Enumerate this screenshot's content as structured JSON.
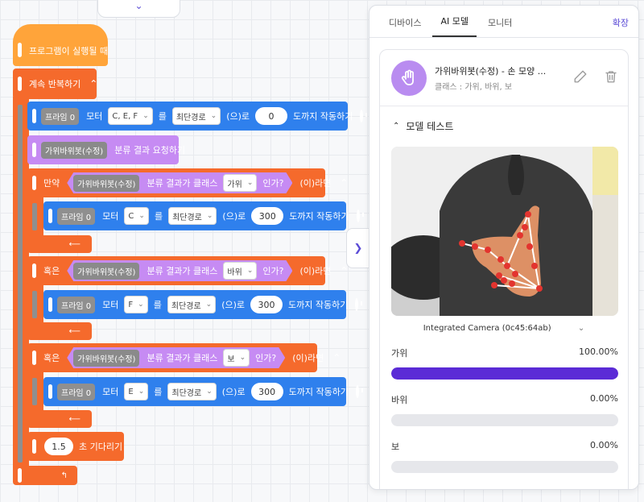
{
  "canvas": {
    "hat_label": "프로그램이 실행될 때",
    "loop_label": "계속 반복하기",
    "motor_block_1": {
      "device": "프라임 0",
      "motor_label": "모터",
      "motors": "C, E, F",
      "particle": "를",
      "mode": "최단경로",
      "suffix_to": "(으)로",
      "value": "0",
      "action": "도까지 작동하기"
    },
    "classify_block": {
      "model": "가위바위봇(수정)",
      "label": "분류 결과 요청하기"
    },
    "if_block": {
      "keyword": "만약",
      "model": "가위바위봇(수정)",
      "cond_label": "분류 결과가 클래스",
      "class": "가위",
      "suffix": "인가?",
      "then": "(이)라면"
    },
    "motor_block_2": {
      "device": "프라임 0",
      "motor_label": "모터",
      "motors": "C",
      "particle": "를",
      "mode": "최단경로",
      "suffix_to": "(으)로",
      "value": "300",
      "action": "도까지 작동하기"
    },
    "elif_block_1": {
      "keyword": "혹은",
      "model": "가위바위봇(수정)",
      "cond_label": "분류 결과가 클래스",
      "class": "바위",
      "suffix": "인가?",
      "then": "(이)라면"
    },
    "motor_block_3": {
      "device": "프라임 0",
      "motor_label": "모터",
      "motors": "F",
      "particle": "를",
      "mode": "최단경로",
      "suffix_to": "(으)로",
      "value": "300",
      "action": "도까지 작동하기"
    },
    "elif_block_2": {
      "keyword": "혹은",
      "model": "가위바위봇(수정)",
      "cond_label": "분류 결과가 클래스",
      "class": "보",
      "suffix": "인가?",
      "then": "(이)라면"
    },
    "motor_block_4": {
      "device": "프라임 0",
      "motor_label": "모터",
      "motors": "E",
      "particle": "를",
      "mode": "최단경로",
      "suffix_to": "(으)로",
      "value": "300",
      "action": "도까지 작동하기"
    },
    "wait_block": {
      "value": "1.5",
      "label": "초 기다리기"
    }
  },
  "panel": {
    "tabs": [
      {
        "label": "디바이스"
      },
      {
        "label": "AI 모델"
      },
      {
        "label": "모니터"
      }
    ],
    "expand_label": "확장",
    "model": {
      "title": "가위바위봇(수정) - 손 모양 ...",
      "classes": "클래스 : 가위, 바위, 보"
    },
    "section_title": "모델 테스트",
    "camera": "Integrated Camera (0c45:64ab)",
    "results": [
      {
        "label": "가위",
        "percent": "100.00%",
        "fraction": 1.0
      },
      {
        "label": "바위",
        "percent": "0.00%",
        "fraction": 0.0
      },
      {
        "label": "보",
        "percent": "0.00%",
        "fraction": 0.0
      }
    ],
    "colors": {
      "accent": "#5b2bd6",
      "avatar": "#b98cf0"
    }
  }
}
